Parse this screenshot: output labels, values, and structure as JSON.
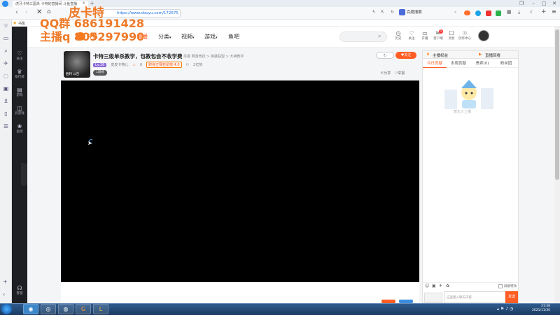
{
  "browser": {
    "tab_title": "虎牙卡特三国杀 卡特的直播间 斗鱼直播",
    "url": "https://www.douyu.com/172675",
    "search_engine_label": "百度搜索",
    "bookmark_label": "书签"
  },
  "watermark": {
    "line1": "皮卡特",
    "line2": "QQ群 686191428",
    "line3": "主播q 805297990"
  },
  "site_nav": {
    "logo_text": "斗鱼",
    "live_label": "直播",
    "items": [
      "分类",
      "视频",
      "游戏",
      "鱼吧"
    ],
    "header_icons": [
      {
        "icon": "history-icon",
        "label": "历史"
      },
      {
        "icon": "heart-icon",
        "label": "关注"
      },
      {
        "icon": "live-icon",
        "label": "开播"
      },
      {
        "icon": "message-icon",
        "label": "客户端",
        "badge": "1"
      },
      {
        "icon": "chat-icon",
        "label": "消息"
      },
      {
        "icon": "bulb-icon",
        "label": "创作中心"
      }
    ]
  },
  "sidebar": {
    "items": [
      {
        "icon": "heart-icon",
        "label": "关注"
      },
      {
        "icon": "rank-icon",
        "label": "排行榜"
      },
      {
        "icon": "game-icon",
        "label": "游戏"
      },
      {
        "icon": "cloud-game-icon",
        "label": "云游戏"
      },
      {
        "icon": "fish-bar-icon",
        "label": "鱼吧"
      }
    ],
    "bottom_label": "客服"
  },
  "room": {
    "title": "卡特三级单杀教学，包教包会不收学费",
    "category": "举报  网游竞技 > 英雄联盟 > 大神教学",
    "anchor_name": "皮皮卡特儿",
    "level_badge": "Lv.26",
    "hot_count": "0",
    "fan_badge": "跻身正赛亚星榜 4.0",
    "online": "2亿热",
    "share_label": "分享",
    "report_label": "举报",
    "follow_label": "关注",
    "avatar_caption": "胜利  公告",
    "tag_label": "1周榜"
  },
  "chat": {
    "top_tabs": [
      "主播权益",
      "直播回看"
    ],
    "rank_tabs": [
      "今日贡献",
      "本周贡献",
      "贵宾(0)",
      "粉丝团"
    ],
    "active_rank_tab": 0,
    "empty_text": "暂无人上榜",
    "input_placeholder": "这里输入聊天内容",
    "send_label": "发送",
    "checkbox_label": "屏蔽特效"
  },
  "taskbar": {
    "time": "21:48",
    "date": "2021/11/30"
  }
}
